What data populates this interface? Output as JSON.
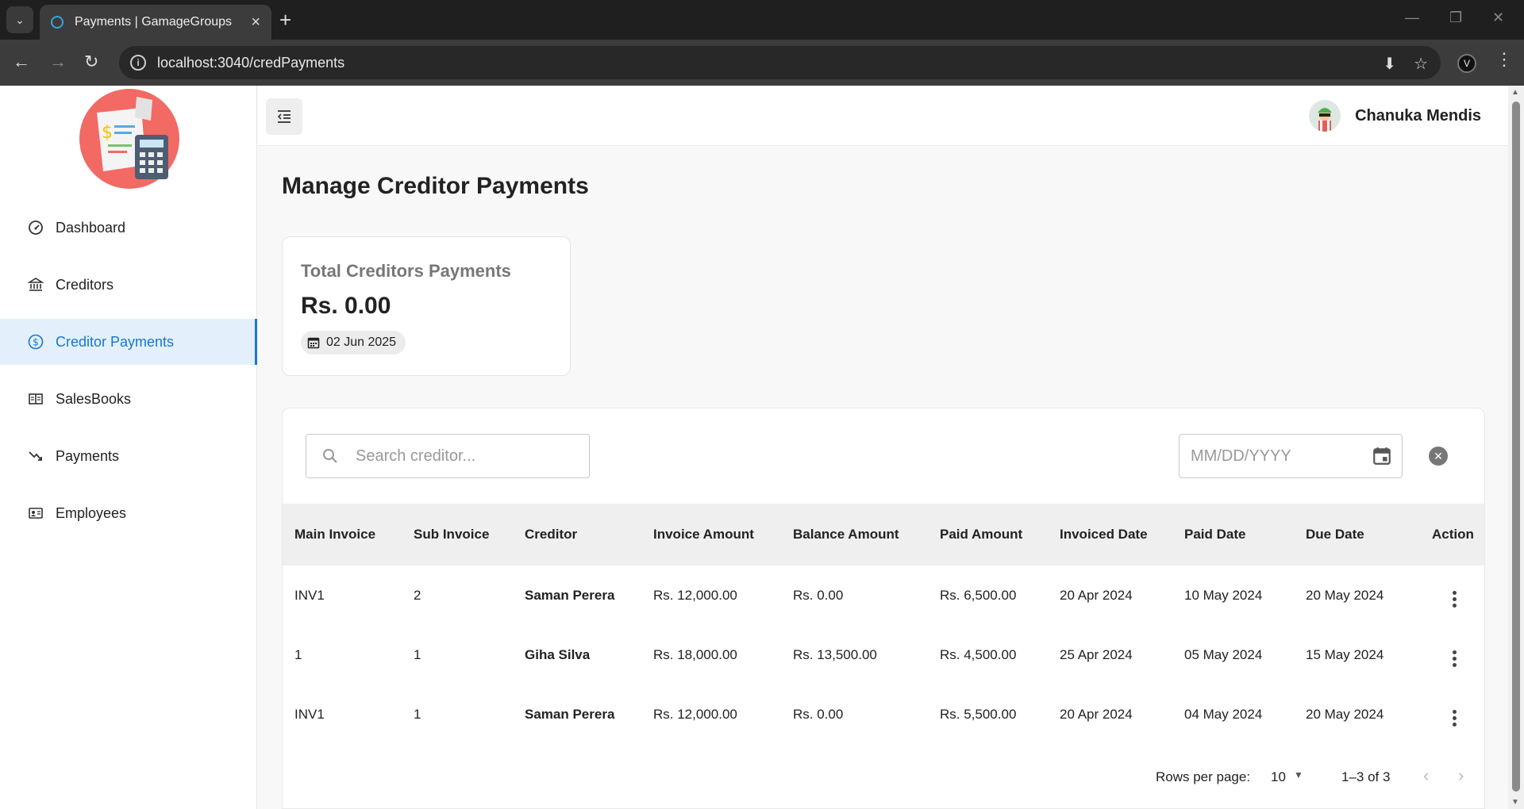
{
  "browser": {
    "tab_title": "Payments | GamageGroups",
    "url": "localhost:3040/credPayments"
  },
  "sidebar": {
    "items": [
      {
        "label": "Dashboard",
        "icon": "dashboard-gauge-icon",
        "active": false
      },
      {
        "label": "Creditors",
        "icon": "bank-icon",
        "active": false
      },
      {
        "label": "Creditor Payments",
        "icon": "dollar-circle-icon",
        "active": true
      },
      {
        "label": "SalesBooks",
        "icon": "book-icon",
        "active": false
      },
      {
        "label": "Payments",
        "icon": "trend-down-icon",
        "active": false
      },
      {
        "label": "Employees",
        "icon": "id-card-icon",
        "active": false
      }
    ]
  },
  "header": {
    "user_name": "Chanuka Mendis"
  },
  "page": {
    "title": "Manage Creditor Payments"
  },
  "summary_card": {
    "label": "Total Creditors Payments",
    "value": "Rs. 0.00",
    "date": "02 Jun 2025"
  },
  "filters": {
    "search_placeholder": "Search creditor...",
    "date_placeholder": "MM/DD/YYYY"
  },
  "table": {
    "columns": [
      "Main Invoice",
      "Sub Invoice",
      "Creditor",
      "Invoice Amount",
      "Balance Amount",
      "Paid Amount",
      "Invoiced Date",
      "Paid Date",
      "Due Date",
      "Action"
    ],
    "rows": [
      [
        "INV1",
        "2",
        "Saman Perera",
        "Rs. 12,000.00",
        "Rs. 0.00",
        "Rs. 6,500.00",
        "20 Apr 2024",
        "10 May 2024",
        "20 May 2024"
      ],
      [
        "1",
        "1",
        "Giha Silva",
        "Rs. 18,000.00",
        "Rs. 13,500.00",
        "Rs. 4,500.00",
        "25 Apr 2024",
        "05 May 2024",
        "15 May 2024"
      ],
      [
        "INV1",
        "1",
        "Saman Perera",
        "Rs. 12,000.00",
        "Rs. 0.00",
        "Rs. 5,500.00",
        "20 Apr 2024",
        "04 May 2024",
        "20 May 2024"
      ]
    ]
  },
  "pagination": {
    "rows_per_page_label": "Rows per page:",
    "rows_per_page": "10",
    "range": "1–3 of 3"
  },
  "colors": {
    "accent": "#1976d2",
    "active_bg": "#e3f0fc"
  }
}
